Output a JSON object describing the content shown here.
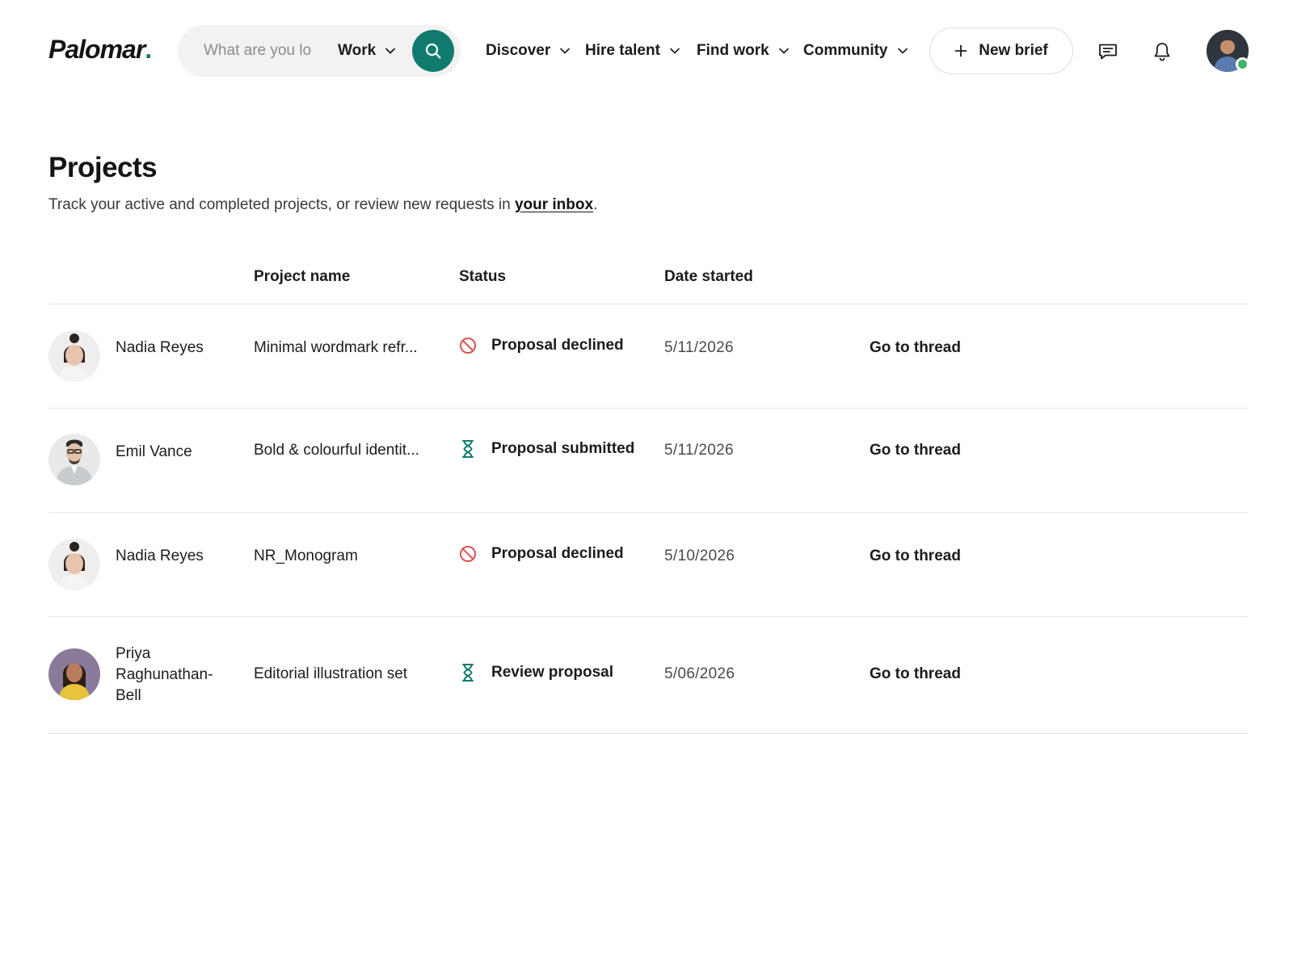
{
  "brand": {
    "name": "Palomar",
    "dot": "."
  },
  "search": {
    "placeholder": "What are you lo",
    "category": "Work"
  },
  "nav": [
    {
      "label": "Discover"
    },
    {
      "label": "Hire talent"
    },
    {
      "label": "Find work"
    },
    {
      "label": "Community"
    }
  ],
  "actions": {
    "new_brief_label": "New brief"
  },
  "page": {
    "title": "Projects",
    "subtitle_prefix": "Track your active and completed projects, or review new requests in ",
    "inbox_link": "your inbox",
    "subtitle_suffix": "."
  },
  "table": {
    "columns": [
      "Project name",
      "Status",
      "Date started"
    ],
    "rows": [
      {
        "client": "Nadia Reyes",
        "project": "Minimal wordmark refr...",
        "status": "Proposal declined",
        "status_icon": "declined-icon",
        "date": "5/11/2026",
        "action": "Go to thread"
      },
      {
        "client": "Emil Vance",
        "project": "Bold & colourful identit...",
        "status": "Proposal submitted",
        "status_icon": "hourglass-icon",
        "date": "5/11/2026",
        "action": "Go to thread"
      },
      {
        "client": "Nadia Reyes",
        "project": "NR_Monogram",
        "status": "Proposal declined",
        "status_icon": "declined-icon",
        "date": "5/10/2026",
        "action": "Go to thread"
      },
      {
        "client": "Priya Raghunathan-Bell",
        "project": "Editorial illustration set",
        "status": "Review proposal",
        "status_icon": "hourglass-icon",
        "date": "5/06/2026",
        "action": "Go to thread"
      }
    ]
  },
  "colors": {
    "accent": "#117a6f",
    "declined": "#d9534f",
    "online": "#3db36b",
    "text": "#1c1c1c"
  }
}
